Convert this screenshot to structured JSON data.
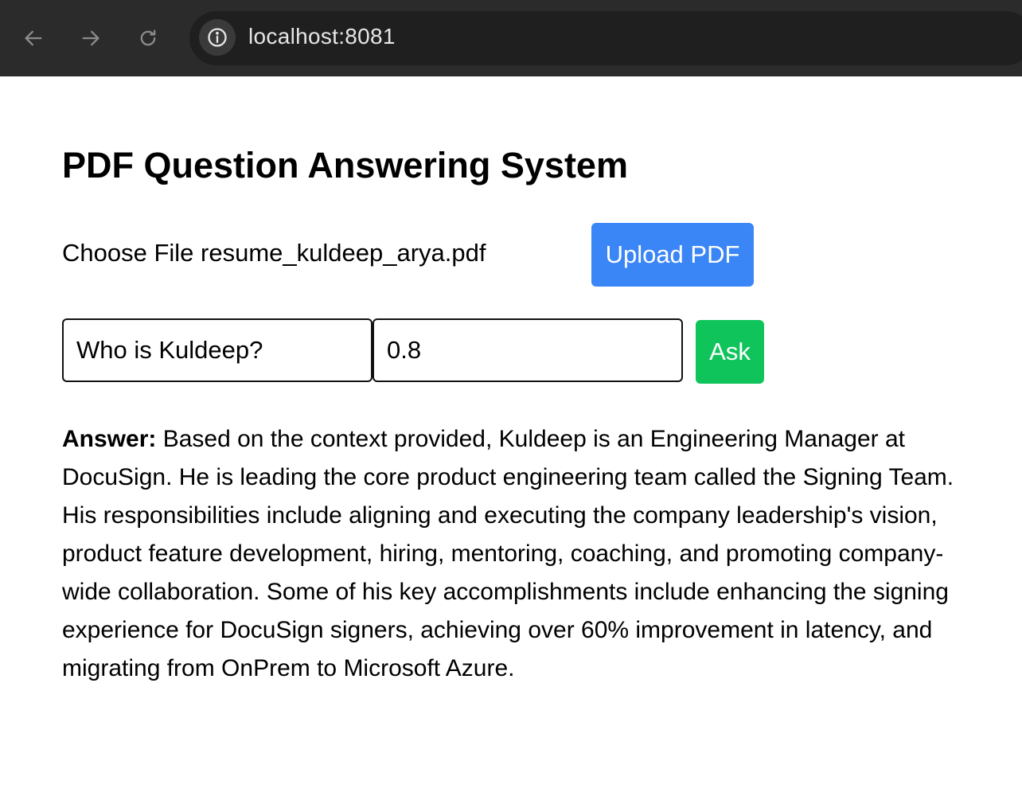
{
  "browser": {
    "url": "localhost:8081",
    "back_icon": "arrow-left-icon",
    "forward_icon": "arrow-right-icon",
    "reload_icon": "reload-icon",
    "info_icon": "info-icon"
  },
  "page": {
    "title": "PDF Question Answering System",
    "file_input": {
      "button_label": "Choose File",
      "file_name": "resume_kuldeep_arya.pdf"
    },
    "upload_button_label": "Upload PDF",
    "question_input_value": "Who is Kuldeep?",
    "temperature_input_value": "0.8",
    "ask_button_label": "Ask",
    "answer_label": "Answer:",
    "answer_text": "Based on the context provided, Kuldeep is an Engineering Manager at DocuSign. He is leading the core product engineering team called the Signing Team. His responsibilities include aligning and executing the company leadership's vision, product feature development, hiring, mentoring, coaching, and promoting company-wide collaboration. Some of his key accomplishments include enhancing the signing experience for DocuSign signers, achieving over 60% improvement in latency, and migrating from OnPrem to Microsoft Azure."
  },
  "colors": {
    "upload_button": "#3a86f6",
    "ask_button": "#10c45c",
    "browser_bar": "#2b2b2b"
  }
}
